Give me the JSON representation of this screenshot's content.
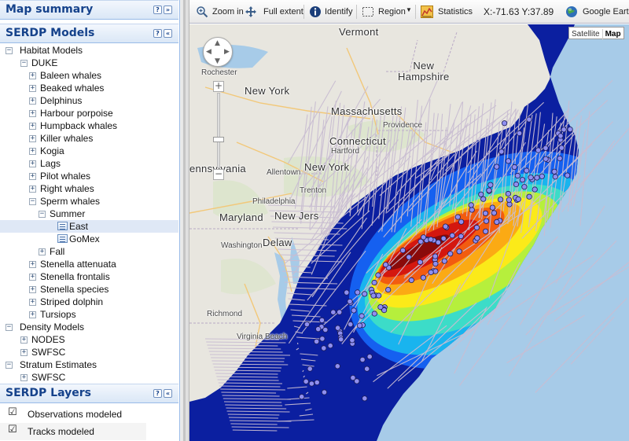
{
  "colors": {
    "header_text": "#15428b",
    "header_bg": "#dae7f6",
    "ocean": "#a7cbe8",
    "land": "#e8e6df",
    "selection": "#dfe8f6",
    "sighting_fill": "#8f8ff0",
    "track_color": "#c7b9cf"
  },
  "panels": {
    "map_summary": {
      "title": "Map summary",
      "icons": [
        "help-icon",
        "expand-icon"
      ]
    },
    "serdp_models": {
      "title": "SERDP Models",
      "icons": [
        "help-icon",
        "collapse-icon"
      ]
    },
    "serdp_layers": {
      "title": "SERDP Layers",
      "icons": [
        "help-icon",
        "collapse-icon"
      ]
    }
  },
  "tree": {
    "nodes": [
      {
        "label": "Habitat Models",
        "level": 0,
        "state": "expanded"
      },
      {
        "label": "DUKE",
        "level": 1,
        "state": "expanded"
      },
      {
        "label": "Baleen whales",
        "level": 2,
        "state": "collapsed"
      },
      {
        "label": "Beaked whales",
        "level": 2,
        "state": "collapsed"
      },
      {
        "label": "Delphinus",
        "level": 2,
        "state": "collapsed"
      },
      {
        "label": "Harbour porpoise",
        "level": 2,
        "state": "collapsed"
      },
      {
        "label": "Humpback whales",
        "level": 2,
        "state": "collapsed"
      },
      {
        "label": "Killer whales",
        "level": 2,
        "state": "collapsed"
      },
      {
        "label": "Kogia",
        "level": 2,
        "state": "collapsed"
      },
      {
        "label": "Lags",
        "level": 2,
        "state": "collapsed"
      },
      {
        "label": "Pilot whales",
        "level": 2,
        "state": "collapsed"
      },
      {
        "label": "Right whales",
        "level": 2,
        "state": "collapsed"
      },
      {
        "label": "Sperm whales",
        "level": 2,
        "state": "expanded"
      },
      {
        "label": "Summer",
        "level": 3,
        "state": "expanded"
      },
      {
        "label": "East",
        "level": 4,
        "state": "leaf",
        "selected": true
      },
      {
        "label": "GoMex",
        "level": 4,
        "state": "leaf"
      },
      {
        "label": "Fall",
        "level": 3,
        "state": "collapsed"
      },
      {
        "label": "Stenella attenuata",
        "level": 2,
        "state": "collapsed"
      },
      {
        "label": "Stenella frontalis",
        "level": 2,
        "state": "collapsed"
      },
      {
        "label": "Stenella species",
        "level": 2,
        "state": "collapsed"
      },
      {
        "label": "Striped dolphin",
        "level": 2,
        "state": "collapsed"
      },
      {
        "label": "Tursiops",
        "level": 2,
        "state": "collapsed"
      },
      {
        "label": "Density Models",
        "level": 0,
        "state": "expanded"
      },
      {
        "label": "NODES",
        "level": 1,
        "state": "collapsed"
      },
      {
        "label": "SWFSC",
        "level": 1,
        "state": "collapsed"
      },
      {
        "label": "Stratum Estimates",
        "level": 0,
        "state": "expanded"
      },
      {
        "label": "SWFSC",
        "level": 1,
        "state": "collapsed"
      }
    ]
  },
  "layers": [
    {
      "label": "Observations modeled",
      "checked": true
    },
    {
      "label": "Tracks modeled",
      "checked": true
    }
  ],
  "toolbar": {
    "zoom_in": "Zoom in",
    "full_extent": "Full extent",
    "identify": "Identify",
    "region": "Region",
    "statistics": "Statistics",
    "coords": "X:-71.63 Y:37.89",
    "google_earth": "Google Earth"
  },
  "map": {
    "type_buttons": [
      "Satellite",
      "Map"
    ],
    "active_type": "Map",
    "labels": {
      "vermont": "Vermont",
      "new_hampshire": "New\nHampshire",
      "rochester": "Rochester",
      "new_york_state": "New York",
      "massachusetts": "Massachusetts",
      "providence": "Providence",
      "connecticut": "Connecticut",
      "hartford": "Hartford",
      "pennsylvania": "ennsylvania",
      "allentown": "Allentown",
      "new_york_city": "New York",
      "trenton": "Trenton",
      "philadelphia": "Philadelphia",
      "maryland": "Maryland",
      "new_jersey": "New Jers",
      "delaware": "Delaw",
      "washington": "Washington",
      "richmond": "Richmond",
      "virginia_beach": "Virginia Beach"
    }
  }
}
